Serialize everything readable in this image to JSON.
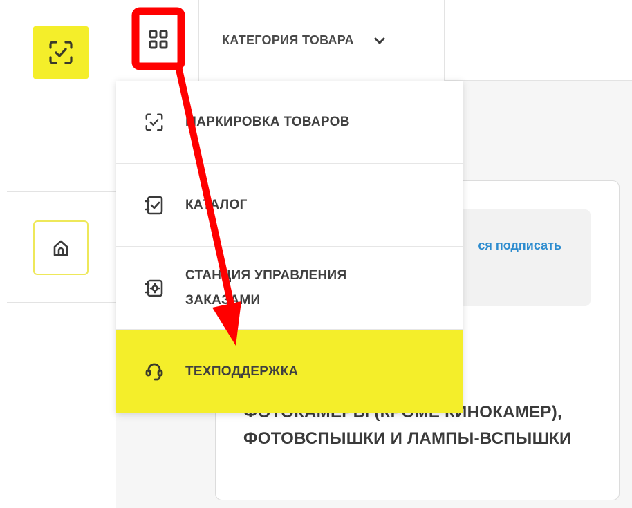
{
  "header": {
    "logo_icon": "scan-check-icon",
    "apps_icon": "grid-icon",
    "category_label": "КАТЕГОРИЯ ТОВАРА",
    "category_chevron": "chevron-down-icon"
  },
  "sidebar": {
    "home_icon": "home-icon"
  },
  "menu": {
    "items": [
      {
        "label": "МАРКИРОВКА ТОВАРОВ",
        "icon": "scan-check-icon",
        "active": false
      },
      {
        "label": "КАТАЛОГ",
        "icon": "catalog-check-icon",
        "active": false
      },
      {
        "label": "СТАНЦИЯ УПРАВЛЕНИЯ ЗАКАЗАМИ",
        "icon": "order-station-icon",
        "active": false
      },
      {
        "label": "ТЕХПОДДЕРЖКА",
        "icon": "headset-icon",
        "active": true
      }
    ]
  },
  "content": {
    "notice_link": "ся подписать",
    "product_title": "ФОТОКАМЕРЫ (КРОМЕ КИНОКАМЕР), ФОТОВСПЫШКИ И ЛАМПЫ-ВСПЫШКИ"
  },
  "colors": {
    "accent": "#f4ee2a",
    "annotation": "#ff0000",
    "link": "#2d8ccf"
  }
}
